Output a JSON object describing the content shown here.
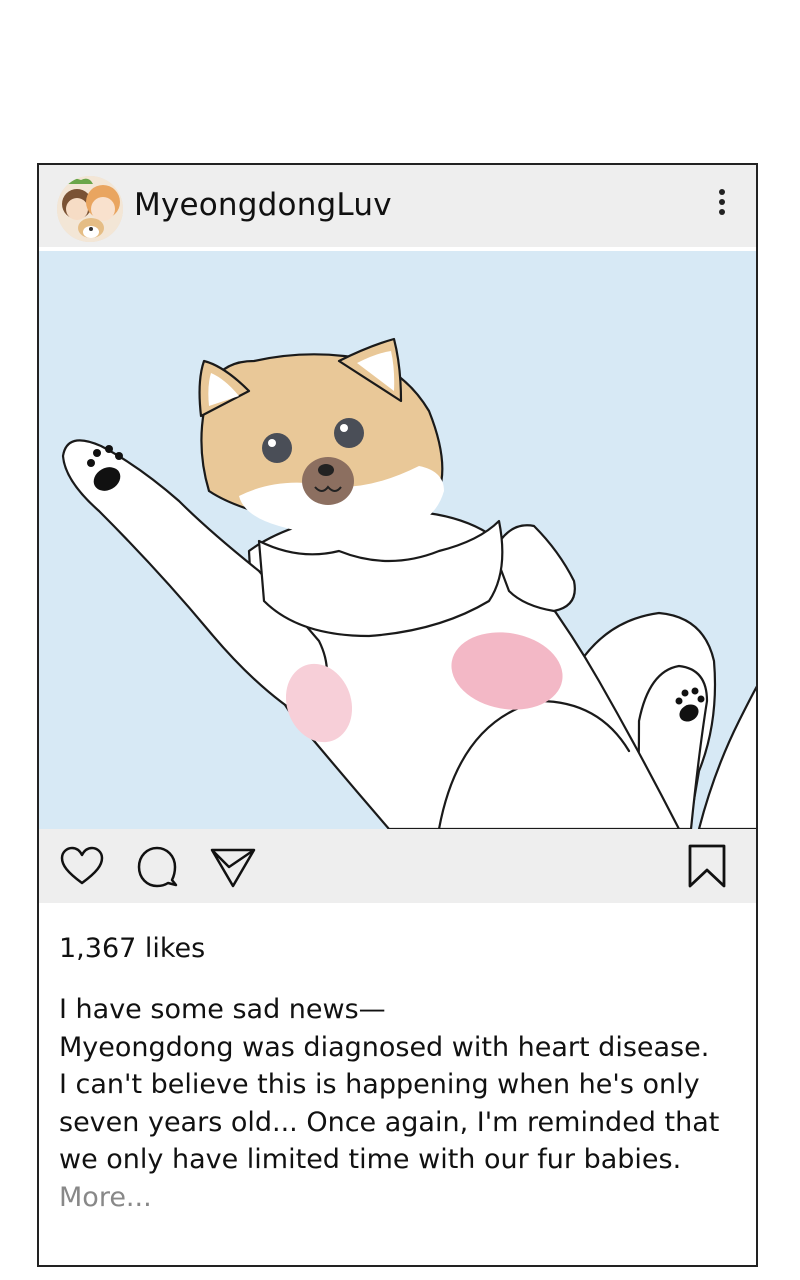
{
  "post": {
    "username": "MyeongdongLuv",
    "likes": "1,367 likes",
    "caption_lines": [
      "I have some sad news—",
      "Myeongdong was diagnosed with heart disease.",
      "I can't believe this is happening when he's only",
      "seven years old... Once again, I'm reminded that",
      "we only have limited time with our fur babies."
    ],
    "more_label": "More..."
  },
  "icons": {
    "menu": "more-vertical-icon",
    "like": "heart-icon",
    "comment": "comment-icon",
    "share": "send-icon",
    "save": "bookmark-icon"
  },
  "colors": {
    "header_bg": "#eeeeee",
    "photo_bg": "#d7e9f5",
    "text": "#111111",
    "muted": "#888888"
  }
}
